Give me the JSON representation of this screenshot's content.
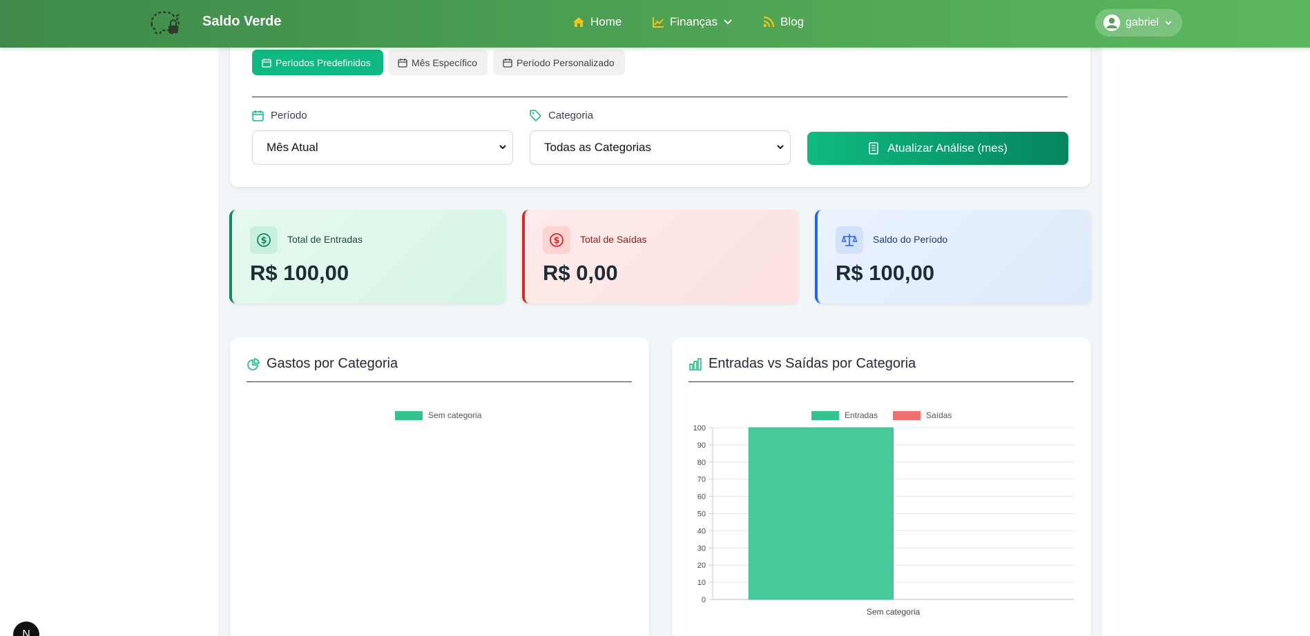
{
  "navbar": {
    "brand": "Saldo Verde",
    "links": [
      {
        "label": "Home",
        "icon": "home-icon"
      },
      {
        "label": "Finanças",
        "icon": "chart-line-icon"
      },
      {
        "label": "Blog",
        "icon": "rss-icon"
      }
    ],
    "user": "gabriel",
    "colors": {
      "gradient_start": "#3f8a4a",
      "gradient_end": "#5bb85d",
      "icon_accent": "#f5c518"
    }
  },
  "filters": {
    "tabs": [
      {
        "label": "Períodos Predefinidos",
        "active": true
      },
      {
        "label": "Mês Específico",
        "active": false
      },
      {
        "label": "Período Personalizado",
        "active": false
      }
    ],
    "period_label": "Período",
    "period_value": "Mês Atual",
    "category_label": "Categoria",
    "category_value": "Todas as Categorias",
    "update_button": "Atualizar Análise (mes)"
  },
  "summary": {
    "entradas": {
      "label": "Total de Entradas",
      "value": "R$ 100,00",
      "color": "#0f8a5f"
    },
    "saidas": {
      "label": "Total de Saídas",
      "value": "R$ 0,00",
      "color": "#dc2626"
    },
    "saldo": {
      "label": "Saldo do Período",
      "value": "R$ 100,00",
      "color": "#2563eb"
    }
  },
  "charts": {
    "pie_title": "Gastos por Categoria",
    "bar_title": "Entradas vs Saídas por Categoria"
  },
  "chart_data": [
    {
      "type": "pie",
      "title": "Gastos por Categoria",
      "categories": [
        "Sem categoria"
      ],
      "values": [
        0
      ],
      "colors": [
        "#34c38f"
      ],
      "legend": "top"
    },
    {
      "type": "bar",
      "title": "Entradas vs Saídas por Categoria",
      "categories": [
        "Sem categoria"
      ],
      "series": [
        {
          "name": "Entradas",
          "values": [
            100
          ],
          "color": "#34c38f"
        },
        {
          "name": "Saídas",
          "values": [
            0
          ],
          "color": "#f07070"
        }
      ],
      "ylim": [
        0,
        100
      ],
      "yticks": [
        0,
        10,
        20,
        30,
        40,
        50,
        60,
        70,
        80,
        90,
        100
      ],
      "grid": true,
      "legend": "top"
    }
  ],
  "badge": "N"
}
